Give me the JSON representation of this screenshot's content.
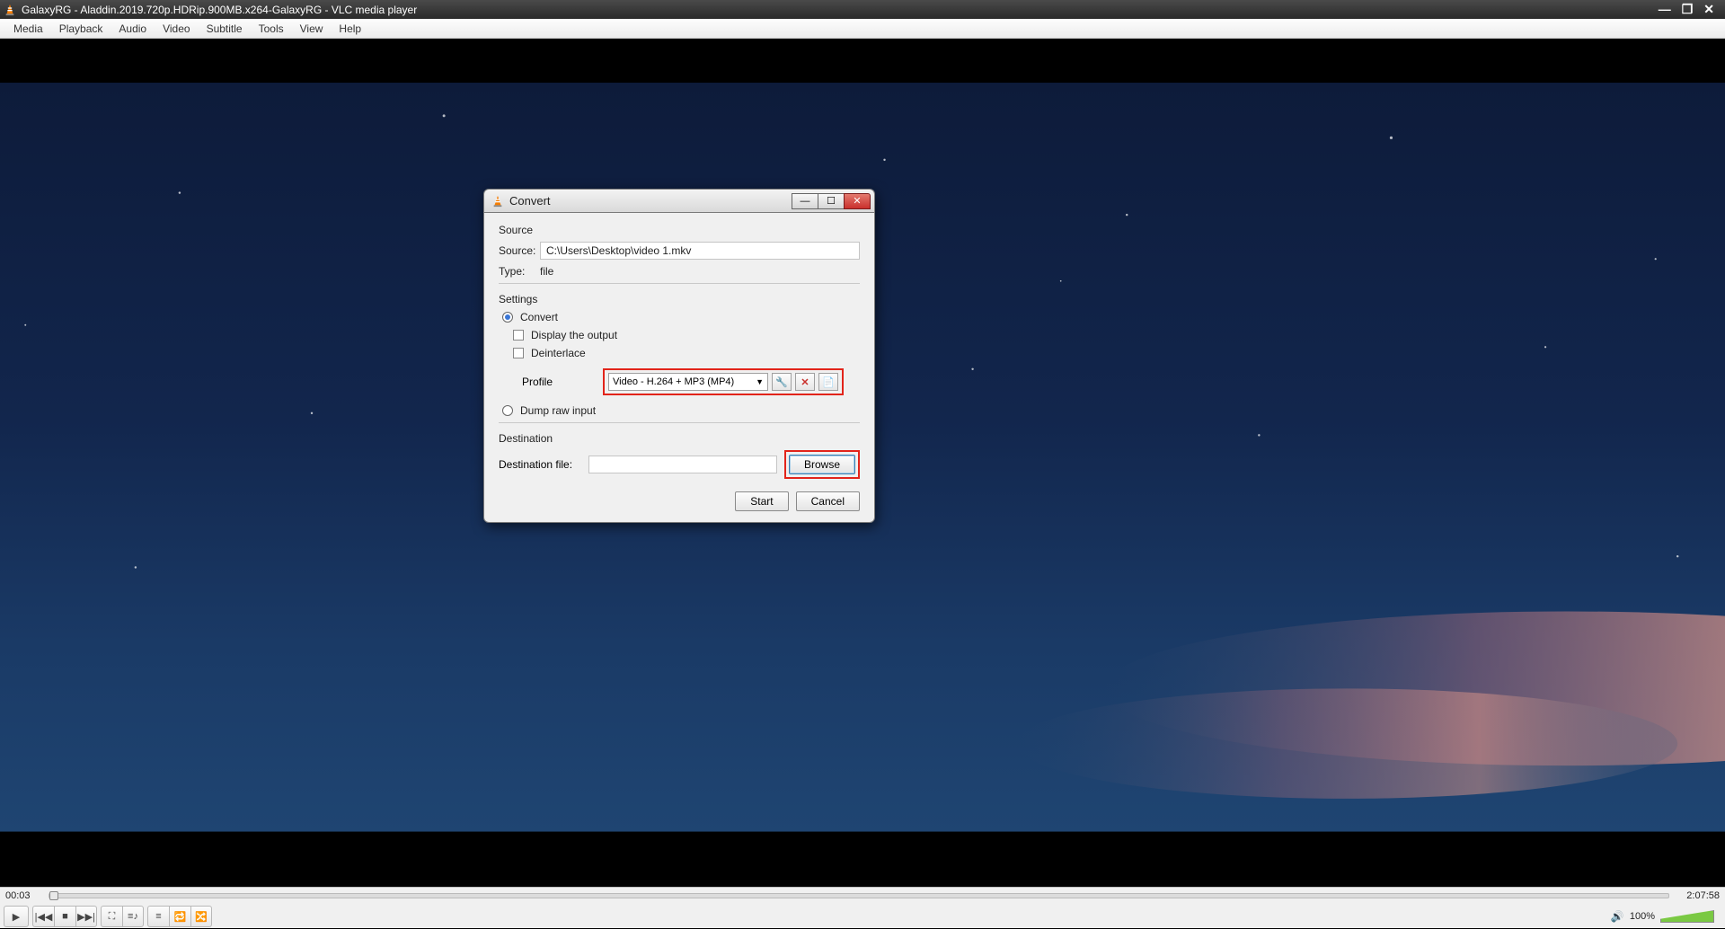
{
  "window": {
    "title": "GalaxyRG - Aladdin.2019.720p.HDRip.900MB.x264-GalaxyRG - VLC media player"
  },
  "menubar": {
    "items": [
      "Media",
      "Playback",
      "Audio",
      "Video",
      "Subtitle",
      "Tools",
      "View",
      "Help"
    ]
  },
  "playback": {
    "current_time": "00:03",
    "total_time": "2:07:58",
    "volume_label": "100%"
  },
  "dialog": {
    "title": "Convert",
    "source_section": "Source",
    "source_label": "Source:",
    "source_value": "C:\\Users\\Desktop\\video 1.mkv",
    "type_label": "Type:",
    "type_value": "file",
    "settings_section": "Settings",
    "convert_radio": "Convert",
    "display_output_check": "Display the output",
    "deinterlace_check": "Deinterlace",
    "profile_label": "Profile",
    "profile_value": "Video - H.264 + MP3 (MP4)",
    "dump_raw_radio": "Dump raw input",
    "destination_section": "Destination",
    "destination_file_label": "Destination file:",
    "destination_file_value": "",
    "browse_btn": "Browse",
    "start_btn": "Start",
    "cancel_btn": "Cancel"
  }
}
